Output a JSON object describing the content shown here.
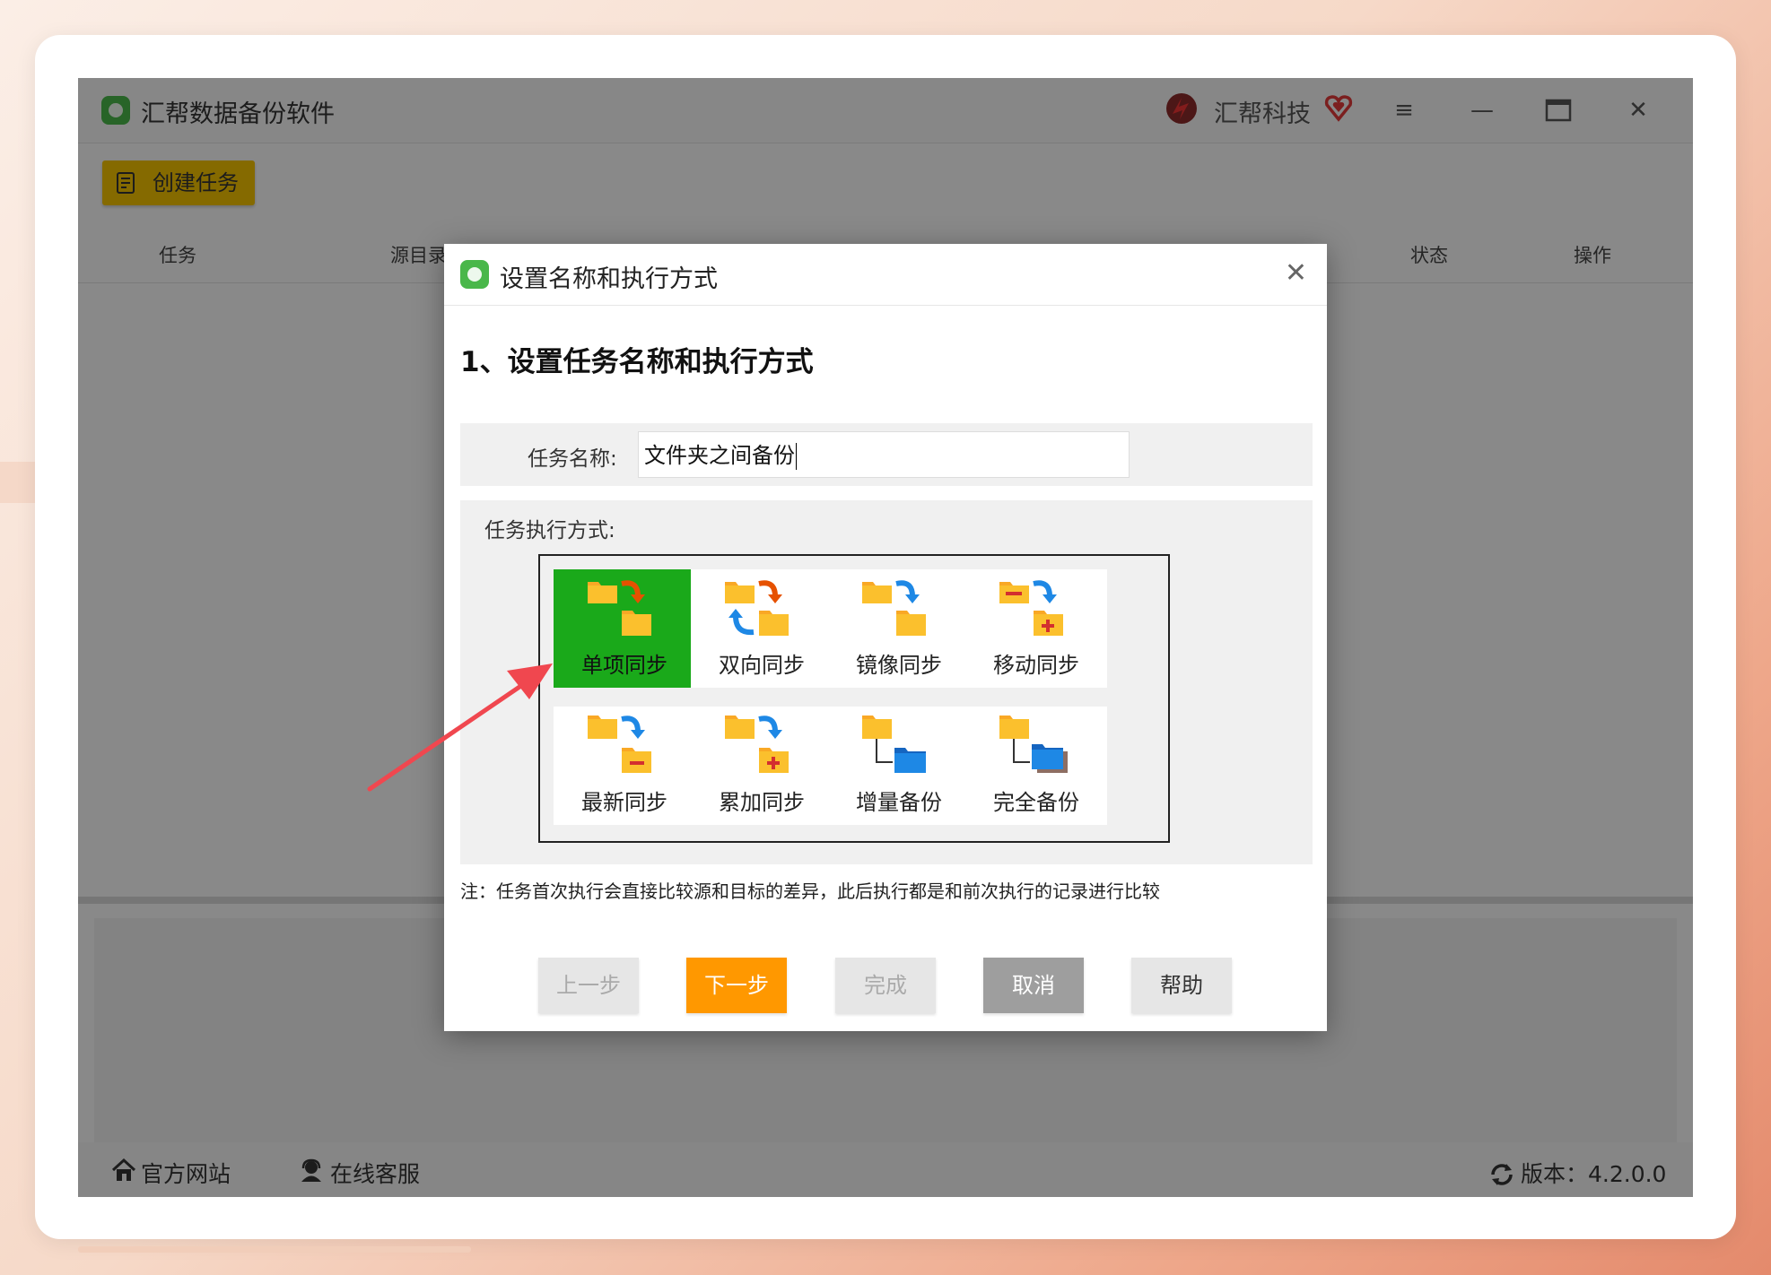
{
  "app": {
    "title": "汇帮数据备份软件",
    "brand": "汇帮科技",
    "create_task_label": "创建任务",
    "columns": [
      "任务",
      "源目录",
      "状态",
      "操作"
    ],
    "footer": {
      "website": "官方网站",
      "support": "在线客服",
      "version": "版本：4.2.0.0"
    }
  },
  "dialog": {
    "title": "设置名称和执行方式",
    "step_title": "1、设置任务名称和执行方式",
    "name_label": "任务名称:",
    "name_value": "文件夹之间备份",
    "mode_label": "任务执行方式:",
    "modes": [
      {
        "label": "单项同步",
        "selected": true,
        "icon": "one-way-sync-icon"
      },
      {
        "label": "双向同步",
        "selected": false,
        "icon": "two-way-sync-icon"
      },
      {
        "label": "镜像同步",
        "selected": false,
        "icon": "mirror-sync-icon"
      },
      {
        "label": "移动同步",
        "selected": false,
        "icon": "move-sync-icon"
      },
      {
        "label": "最新同步",
        "selected": false,
        "icon": "latest-sync-icon"
      },
      {
        "label": "累加同步",
        "selected": false,
        "icon": "cumulative-sync-icon"
      },
      {
        "label": "增量备份",
        "selected": false,
        "icon": "incremental-backup-icon"
      },
      {
        "label": "完全备份",
        "selected": false,
        "icon": "full-backup-icon"
      }
    ],
    "note": "注：任务首次执行会直接比较源和目标的差异，此后执行都是和前次执行的记录进行比较",
    "buttons": {
      "prev": "上一步",
      "next": "下一步",
      "finish": "完成",
      "cancel": "取消",
      "help": "帮助"
    }
  },
  "colors": {
    "selected_tile": "#1aa91a",
    "primary_button": "#ff9800",
    "create_button": "#f2c200",
    "annotation_arrow": "#f0474f"
  }
}
